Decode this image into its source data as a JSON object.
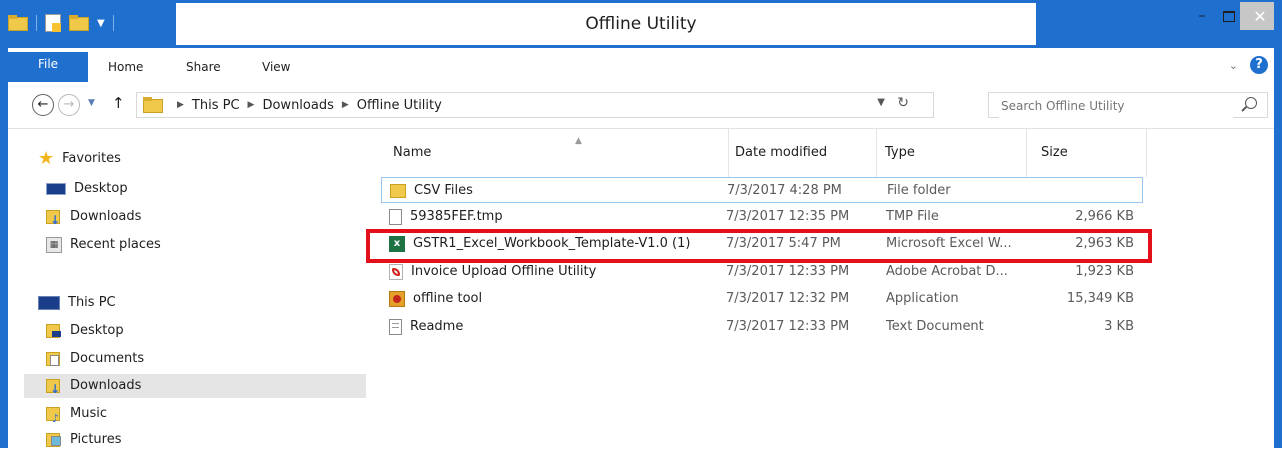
{
  "window": {
    "title": "Offline Utility",
    "controls": {
      "minimize": "–",
      "maximize": "□",
      "close": "✕"
    }
  },
  "ribbon": {
    "tabs": [
      {
        "label": "File",
        "active": true
      },
      {
        "label": "Home"
      },
      {
        "label": "Share"
      },
      {
        "label": "View"
      }
    ],
    "help": "?"
  },
  "address": {
    "breadcrumbs": [
      "This PC",
      "Downloads",
      "Offline Utility"
    ],
    "search_placeholder": "Search Offline Utility"
  },
  "sidebar": {
    "favorites": {
      "label": "Favorites",
      "items": [
        {
          "label": "Desktop",
          "icon": "desktop-icon"
        },
        {
          "label": "Downloads",
          "icon": "downloads-folder-icon"
        },
        {
          "label": "Recent places",
          "icon": "recent-places-icon"
        }
      ]
    },
    "this_pc": {
      "label": "This PC",
      "items": [
        {
          "label": "Desktop",
          "icon": "desktop-folder-icon"
        },
        {
          "label": "Documents",
          "icon": "documents-folder-icon"
        },
        {
          "label": "Downloads",
          "icon": "downloads-folder-icon",
          "selected": true
        },
        {
          "label": "Music",
          "icon": "music-folder-icon"
        },
        {
          "label": "Pictures",
          "icon": "pictures-folder-icon"
        }
      ]
    }
  },
  "filelist": {
    "columns": [
      "Name",
      "Date modified",
      "Type",
      "Size"
    ],
    "rows": [
      {
        "name": "CSV Files",
        "date": "7/3/2017 4:28 PM",
        "type": "File folder",
        "size": "",
        "icon": "folder-icon"
      },
      {
        "name": "59385FEF.tmp",
        "date": "7/3/2017 12:35 PM",
        "type": "TMP File",
        "size": "2,966 KB",
        "icon": "file-icon"
      },
      {
        "name": "GSTR1_Excel_Workbook_Template-V1.0 (1)",
        "date": "7/3/2017 5:47 PM",
        "type": "Microsoft Excel W...",
        "size": "2,963 KB",
        "icon": "excel-icon"
      },
      {
        "name": "Invoice Upload Offline Utility",
        "date": "7/3/2017 12:33 PM",
        "type": "Adobe Acrobat D...",
        "size": "1,923 KB",
        "icon": "pdf-icon"
      },
      {
        "name": "offline tool",
        "date": "7/3/2017 12:32 PM",
        "type": "Application",
        "size": "15,349 KB",
        "icon": "application-icon"
      },
      {
        "name": "Readme",
        "date": "7/3/2017 12:33 PM",
        "type": "Text Document",
        "size": "3 KB",
        "icon": "text-document-icon"
      }
    ]
  },
  "colors": {
    "accent": "#1f6fcf",
    "highlight": "#e3101c"
  }
}
